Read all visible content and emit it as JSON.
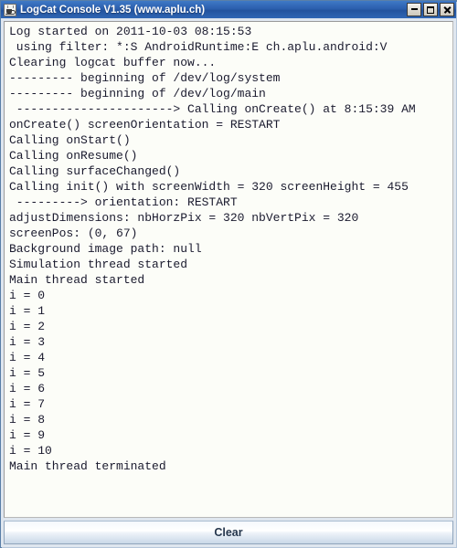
{
  "window": {
    "title": "LogCat Console V1.35 (www.aplu.ch)",
    "icon": "java-coffee-cup-icon",
    "controls": {
      "minimize_label": "_",
      "maximize_label": "□",
      "close_label": "×"
    },
    "colors": {
      "titlebar_blue": "#2b5fae",
      "title_text": "#ffffff",
      "frame": "#b6c7db",
      "panel_background": "#dfe6ef",
      "text_area_background": "#fcfdf8",
      "log_text": "#1a1a2e",
      "button_text": "#26374d"
    }
  },
  "log": {
    "lines": [
      "Log started on 2011-10-03 08:15:53",
      " using filter: *:S AndroidRuntime:E ch.aplu.android:V",
      "Clearing logcat buffer now...",
      "--------- beginning of /dev/log/system",
      "--------- beginning of /dev/log/main",
      " ----------------------> Calling onCreate() at 8:15:39 AM",
      "onCreate() screenOrientation = RESTART",
      "Calling onStart()",
      "Calling onResume()",
      "Calling surfaceChanged()",
      "Calling init() with screenWidth = 320 screenHeight = 455",
      " ---------> orientation: RESTART",
      "adjustDimensions: nbHorzPix = 320 nbVertPix = 320",
      "screenPos: (0, 67)",
      "Background image path: null",
      "Simulation thread started",
      "Main thread started",
      "i = 0",
      "i = 1",
      "i = 2",
      "i = 3",
      "i = 4",
      "i = 5",
      "i = 6",
      "i = 7",
      "i = 8",
      "i = 9",
      "i = 10",
      "Main thread terminated"
    ]
  },
  "actions": {
    "clear_label": "Clear"
  }
}
